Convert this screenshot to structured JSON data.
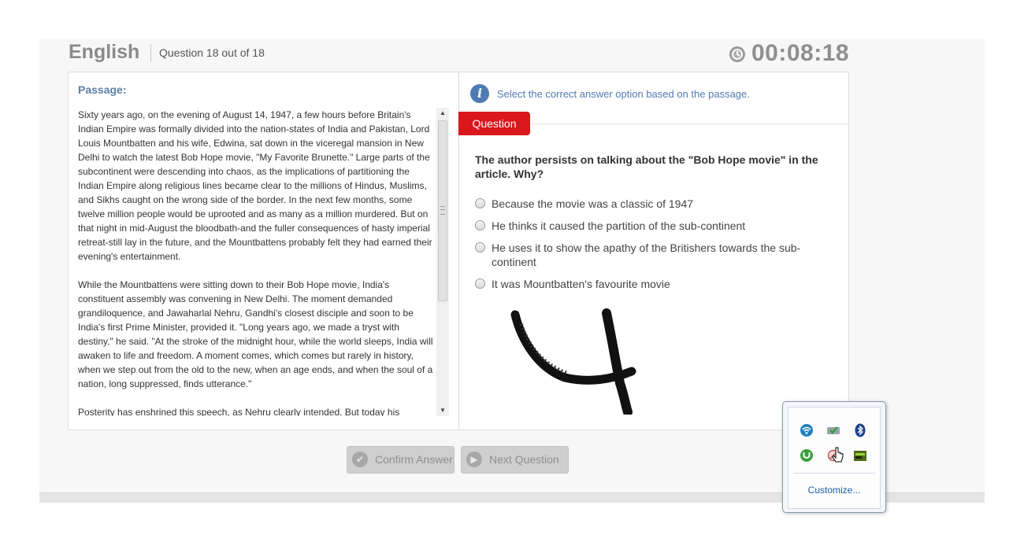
{
  "header": {
    "subject": "English",
    "question_counter": "Question 18 out of 18",
    "timer": "00:08:18"
  },
  "passage": {
    "title": "Passage:",
    "paragraphs": [
      "Sixty years ago, on the evening of August 14, 1947, a few hours before Britain's Indian Empire was formally divided into the nation-states of India and Pakistan, Lord Louis Mountbatten and his wife, Edwina, sat down in the viceregal mansion in New Delhi to watch the latest Bob Hope movie, \"My Favorite Brunette.\" Large parts of the subcontinent were descending into chaos, as the implications of partitioning the Indian Empire along religious lines became clear to the millions of Hindus, Muslims, and Sikhs caught on the wrong side of the border. In the next few months, some twelve million people would be uprooted and as many as a million murdered. But on that night in mid-August the bloodbath-and the fuller consequences of hasty imperial retreat-still lay in the future, and the Mountbattens probably felt they had earned their evening's entertainment.",
      "While the Mountbattens were sitting down to their Bob Hope movie, India's constituent assembly was convening in New Delhi. The moment demanded grandiloquence, and Jawaharlal Nehru, Gandhi's closest disciple and soon to be India's first Prime Minister, provided it. \"Long years ago, we made a tryst with destiny,\" he said. \"At the stroke of the midnight hour, while the world sleeps, India will awaken to life and freedom. A moment comes, which comes but rarely in history, when we step out from the old to the new, when an age ends, and when the soul of a nation, long suppressed, finds utterance.\"",
      "Posterity has enshrined this speech, as Nehru clearly intended. But today his"
    ]
  },
  "question_panel": {
    "instruction": "Select the correct answer option based on the passage.",
    "tab_label": "Question",
    "question_text": "The author persists on talking about the \"Bob Hope movie\" in the article. Why?",
    "options": [
      "Because the movie was a classic of 1947",
      "He thinks it caused the partition of the sub-continent",
      "He uses it to show the apathy of the Britishers towards the sub-continent",
      "It was Mountbatten's favourite movie"
    ]
  },
  "buttons": {
    "confirm": "Confirm Answer",
    "next": "Next Question"
  },
  "tray": {
    "icons": [
      "wifi-icon",
      "network-check-icon",
      "bluetooth-icon",
      "utorrent-icon",
      "blocked-app-icon",
      "battery-icon"
    ],
    "customize": "Customize..."
  },
  "colors": {
    "accent_blue": "#4f7bb3",
    "question_tab_red": "#d9171c",
    "timer_gray": "#8f8f8f"
  }
}
